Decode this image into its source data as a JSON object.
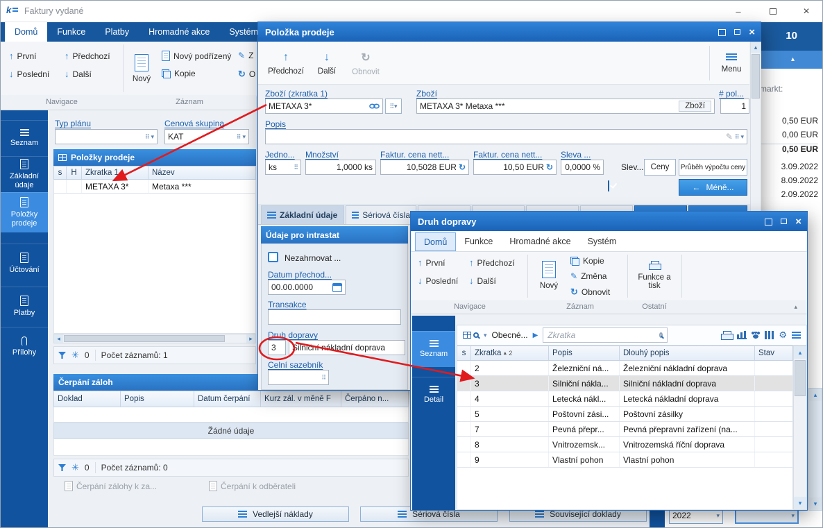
{
  "icons": {
    "up_arrow": "↑",
    "down_arrow": "↓",
    "refresh": "↻",
    "close": "×",
    "minimize": "–",
    "chevron_down": "▾",
    "chevron_up": "▴",
    "chevron_left": "◂",
    "chevron_right": "▸",
    "left_arrow": "←",
    "pencil": "✎",
    "gear": "⚙",
    "asterisk": "✳",
    "play": "▶",
    "dots": "⠿",
    "sort_asc": "▲"
  },
  "colors": {
    "titlebar_blue": "#1c6bc4",
    "sidebar_blue": "#11539f",
    "accent_blue": "#2d7ed3",
    "annotation_red": "#e01b1e"
  },
  "main_window": {
    "title": "Faktury vydané",
    "tabs": [
      "Domů",
      "Funkce",
      "Platby",
      "Hromadné akce",
      "Systém"
    ],
    "ribbon": {
      "first": "První",
      "last": "Poslední",
      "previous": "Předchozí",
      "next": "Další",
      "new": "Nový",
      "new_child": "Nový podřízený",
      "copy": "Kopie",
      "change_fragment": "Z",
      "refresh_fragment": "O",
      "group_navigation": "Navigace",
      "group_record": "Záznam"
    },
    "sidebar": [
      {
        "label": "Seznam"
      },
      {
        "label": "Základní údaje"
      },
      {
        "label": "Položky prodeje"
      },
      {
        "label": "Účtování"
      },
      {
        "label": "Platby"
      },
      {
        "label": "Přílohy"
      }
    ],
    "filters": {
      "plan_type_label": "Typ plánu",
      "price_group_label": "Cenová skupina",
      "price_group_value": "KAT"
    },
    "items_panel": {
      "title": "Položky prodeje",
      "columns": [
        "s",
        "H",
        "Zkratka 1",
        "Název"
      ],
      "row": {
        "zkratka": "METAXA 3*",
        "nazev": "Metaxa ***"
      },
      "filter_count": "0",
      "record_count": "Počet záznamů: 1"
    },
    "advances_panel": {
      "title": "Čerpání záloh",
      "columns": [
        "Doklad",
        "Popis",
        "Datum čerpání",
        "Kurz zál. v měně F",
        "Čerpáno n..."
      ],
      "empty_text": "Žádné údaje",
      "filter_count": "0",
      "record_count": "Počet záznamů: 0",
      "link1": "Čerpání zálohy k za...",
      "link2": "Čerpání k odběrateli"
    },
    "bottom_buttons": [
      "Vedlejší náklady",
      "Sériová čísla",
      "Související doklady"
    ],
    "right_panel": {
      "page_indicator": "10",
      "label_fragment": "markt:",
      "amounts": [
        "0,50 EUR",
        "0,00 EUR",
        "0,50 EUR"
      ],
      "dates": [
        "3.09.2022",
        "8.09.2022",
        "2.09.2022"
      ],
      "year_value": "2022"
    }
  },
  "sale_item_dialog": {
    "title": "Položka prodeje",
    "toolbar": {
      "previous": "Předchozí",
      "next": "Další",
      "refresh": "Obnovit",
      "menu": "Menu"
    },
    "goods_short_label": "Zboží (zkratka 1)",
    "goods_short_value": "METAXA 3*",
    "goods_label": "Zboží",
    "goods_value": "METAXA 3* Metaxa ***",
    "goods_button": "Zboží",
    "pos_label": "# pol...",
    "pos_value": "1",
    "description_label": "Popis",
    "unit_label": "Jedno...",
    "unit_value": "ks",
    "quantity_label": "Množství",
    "quantity_value": "1,0000 ks",
    "price_net_label": "Faktur. cena nett...",
    "price_net_value": "10,5028 EUR",
    "price_net2_label": "Faktur. cena nett...",
    "price_net2_value": "10,50 EUR",
    "discount_label": "Sleva ...",
    "discount_value": "0,0000 %",
    "discount_checkbox_label": "Slev...",
    "prices_button": "Ceny",
    "price_calc_button": "Průběh výpočtu ceny",
    "less_button": "Méně...",
    "tab1": "Základní údaje",
    "tab2": "Sériová čísla",
    "intrastat": {
      "title": "Údaje pro intrastat",
      "exclude_label": "Nezahrnovat ...",
      "date_label": "Datum přechod...",
      "date_value": "00.00.0000",
      "transaction_label": "Transakce",
      "transport_label": "Druh dopravy",
      "transport_code": "3",
      "transport_text": "Silniční nákladní doprava",
      "tariff_label": "Celní sazebník"
    }
  },
  "transport_dialog": {
    "title": "Druh dopravy",
    "tabs": [
      "Domů",
      "Funkce",
      "Hromadné akce",
      "Systém"
    ],
    "ribbon": {
      "first": "První",
      "last": "Poslední",
      "previous": "Předchozí",
      "next": "Další",
      "new": "Nový",
      "copy": "Kopie",
      "change": "Změna",
      "refresh": "Obnovit",
      "functions_print": "Funkce a tisk",
      "group_navigation": "Navigace",
      "group_record": "Záznam",
      "group_other": "Ostatní"
    },
    "sidebar": [
      {
        "label": "Seznam"
      },
      {
        "label": "Detail"
      }
    ],
    "toolbar": {
      "view_name": "Obecné...",
      "search_placeholder": "Zkratka"
    },
    "grid": {
      "columns": [
        "s",
        "Zkratka",
        "Popis",
        "Dlouhý popis",
        "Stav"
      ],
      "sort_number": "2",
      "rows": [
        {
          "zkratka": "2",
          "popis": "Železniční ná...",
          "dlouhy_popis": "Železniční nákladní doprava"
        },
        {
          "zkratka": "3",
          "popis": "Silniční nákla...",
          "dlouhy_popis": "Silniční nákladní doprava"
        },
        {
          "zkratka": "4",
          "popis": "Letecká nákl...",
          "dlouhy_popis": "Letecká nákladní doprava"
        },
        {
          "zkratka": "5",
          "popis": "Poštovní zási...",
          "dlouhy_popis": "Poštovní zásilky"
        },
        {
          "zkratka": "7",
          "popis": "Pevná přepr...",
          "dlouhy_popis": "Pevná přepravní zařízení (na..."
        },
        {
          "zkratka": "8",
          "popis": "Vnitrozemsk...",
          "dlouhy_popis": "Vnitrozemská říční doprava"
        },
        {
          "zkratka": "9",
          "popis": "Vlastní pohon",
          "dlouhy_popis": "Vlastní pohon"
        }
      ]
    }
  }
}
